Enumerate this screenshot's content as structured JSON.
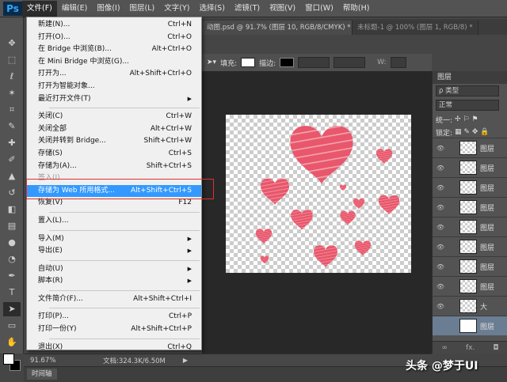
{
  "app": {
    "logo": "Ps"
  },
  "menubar": {
    "items": [
      "文件(F)",
      "编辑(E)",
      "图像(I)",
      "图层(L)",
      "文字(Y)",
      "选择(S)",
      "滤镜(T)",
      "视图(V)",
      "窗口(W)",
      "帮助(H)"
    ],
    "active_index": 0
  },
  "doc_tabs": [
    {
      "label": "动图.psd @ 91.7% (图层 10, RGB/8/CMYK) *",
      "active": true
    },
    {
      "label": "未标题-1 @ 100% (图层 1, RGB/8) *",
      "active": false
    }
  ],
  "options_bar": {
    "fill_label": "填充:",
    "stroke_label": "描边:",
    "width_label": "W:"
  },
  "file_menu": {
    "items": [
      {
        "label": "新建(N)...",
        "shortcut": "Ctrl+N"
      },
      {
        "label": "打开(O)...",
        "shortcut": "Ctrl+O"
      },
      {
        "label": "在 Bridge 中浏览(B)...",
        "shortcut": "Alt+Ctrl+O"
      },
      {
        "label": "在 Mini Bridge 中浏览(G)...",
        "shortcut": ""
      },
      {
        "label": "打开为...",
        "shortcut": "Alt+Shift+Ctrl+O"
      },
      {
        "label": "打开为智能对象...",
        "shortcut": ""
      },
      {
        "label": "最近打开文件(T)",
        "shortcut": "",
        "submenu": true
      },
      {
        "sep": true
      },
      {
        "label": "关闭(C)",
        "shortcut": "Ctrl+W"
      },
      {
        "label": "关闭全部",
        "shortcut": "Alt+Ctrl+W"
      },
      {
        "label": "关闭并转到 Bridge...",
        "shortcut": "Shift+Ctrl+W"
      },
      {
        "label": "存储(S)",
        "shortcut": "Ctrl+S"
      },
      {
        "label": "存储为(A)...",
        "shortcut": "Shift+Ctrl+S"
      },
      {
        "label": "签入(I)...",
        "shortcut": "",
        "disabled": true
      },
      {
        "label": "存储为 Web 所用格式...",
        "shortcut": "Alt+Shift+Ctrl+S",
        "highlighted": true
      },
      {
        "label": "恢复(V)",
        "shortcut": "F12"
      },
      {
        "sep": true
      },
      {
        "label": "置入(L)...",
        "shortcut": ""
      },
      {
        "sep": true
      },
      {
        "label": "导入(M)",
        "shortcut": "",
        "submenu": true
      },
      {
        "label": "导出(E)",
        "shortcut": "",
        "submenu": true
      },
      {
        "sep": true
      },
      {
        "label": "自动(U)",
        "shortcut": "",
        "submenu": true
      },
      {
        "label": "脚本(R)",
        "shortcut": "",
        "submenu": true
      },
      {
        "sep": true
      },
      {
        "label": "文件简介(F)...",
        "shortcut": "Alt+Shift+Ctrl+I"
      },
      {
        "sep": true
      },
      {
        "label": "打印(P)...",
        "shortcut": "Ctrl+P"
      },
      {
        "label": "打印一份(Y)",
        "shortcut": "Alt+Shift+Ctrl+P"
      },
      {
        "sep": true
      },
      {
        "label": "退出(X)",
        "shortcut": "Ctrl+Q"
      }
    ]
  },
  "layers_panel": {
    "title": "图层",
    "filter_label": "ρ 类型",
    "blend_mode": "正常",
    "unify_label": "统一:",
    "lock_label": "锁定:",
    "layers": [
      {
        "name": "图层",
        "visible": true
      },
      {
        "name": "图层",
        "visible": true
      },
      {
        "name": "图层",
        "visible": true
      },
      {
        "name": "图层",
        "visible": true
      },
      {
        "name": "图层",
        "visible": true
      },
      {
        "name": "图层",
        "visible": true
      },
      {
        "name": "图层",
        "visible": true
      },
      {
        "name": "图层",
        "visible": true
      },
      {
        "name": "大",
        "visible": true
      },
      {
        "name": "图层",
        "visible": false,
        "selected": true,
        "white": true
      }
    ],
    "footer": [
      "∞",
      "fx.",
      "◘"
    ]
  },
  "status_bar": {
    "zoom": "91.67%",
    "doc_info": "文档:324.3K/6.50M"
  },
  "timeline": {
    "tab_label": "时间轴"
  },
  "watermark": "头条 @梦于UI",
  "colors": {
    "highlight": "#3399ff",
    "heart": "#e8576c",
    "red_box": "#e03030"
  }
}
